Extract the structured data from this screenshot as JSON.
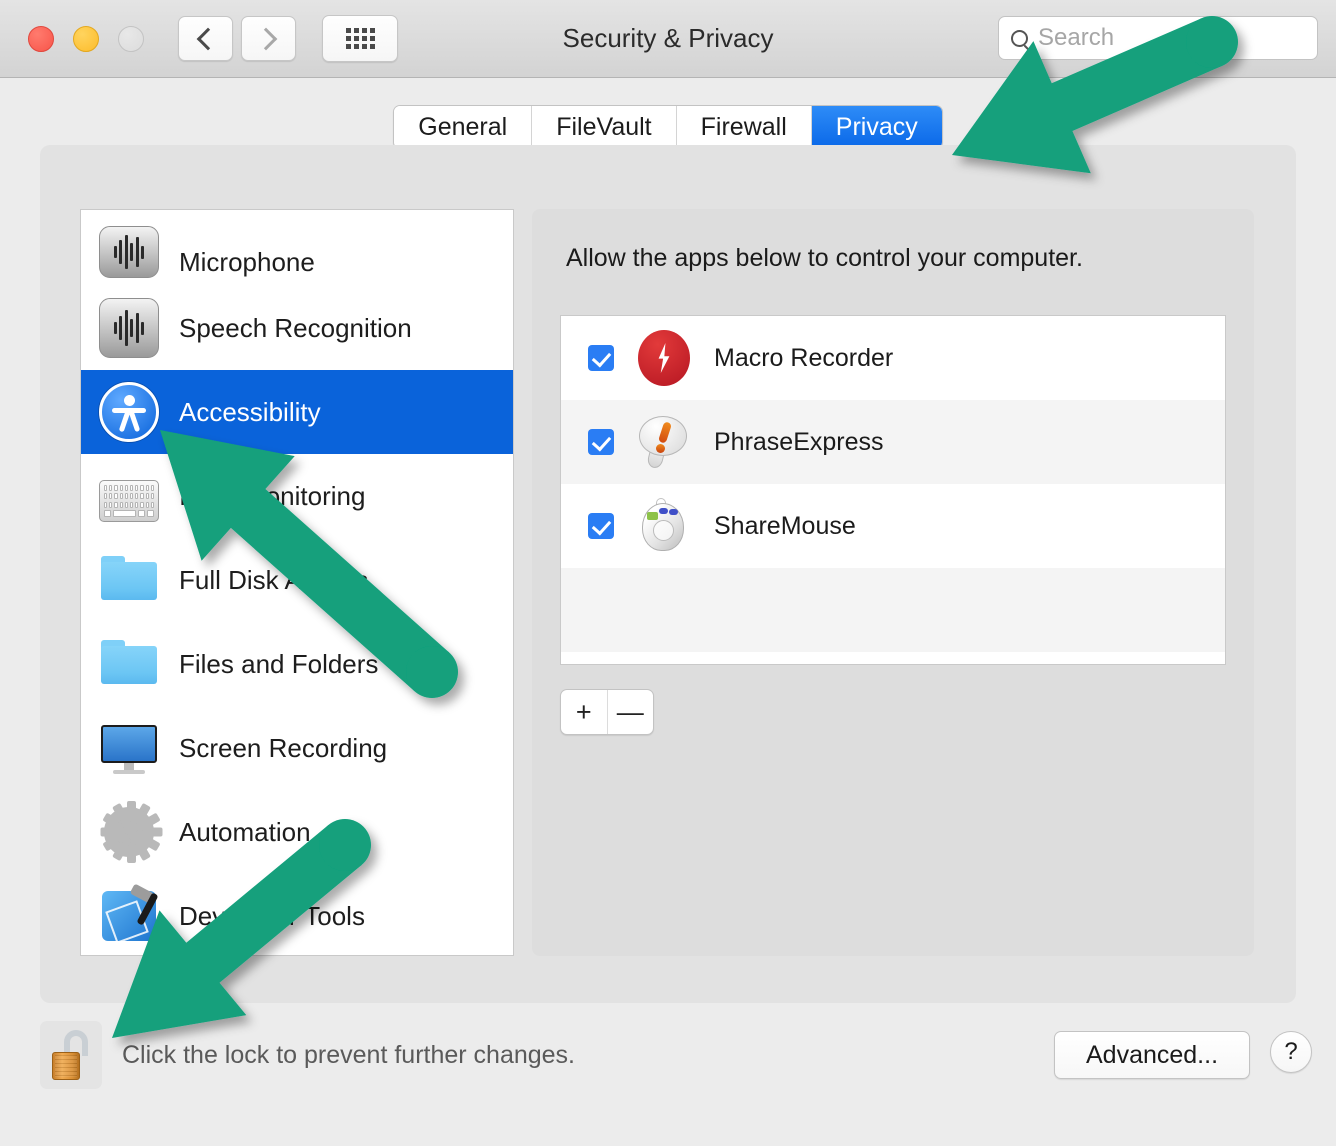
{
  "window": {
    "title": "Security & Privacy",
    "traffic_lights": [
      "close",
      "minimize",
      "zoom"
    ],
    "nav": {
      "back": "back-chevron",
      "forward": "forward-chevron",
      "show_all": "grid-icon"
    },
    "search": {
      "placeholder": "Search",
      "value": "",
      "icon": "search-icon"
    }
  },
  "tabs": [
    {
      "label": "General",
      "active": false
    },
    {
      "label": "FileVault",
      "active": false
    },
    {
      "label": "Firewall",
      "active": false
    },
    {
      "label": "Privacy",
      "active": true
    }
  ],
  "sidebar": {
    "items": [
      {
        "label": "Microphone",
        "icon": "microphone-icon",
        "selected": false
      },
      {
        "label": "Speech Recognition",
        "icon": "microphone-icon",
        "selected": false
      },
      {
        "label": "Accessibility",
        "icon": "accessibility-icon",
        "selected": true
      },
      {
        "label": "Input Monitoring",
        "icon": "keyboard-icon",
        "selected": false
      },
      {
        "label": "Full Disk Access",
        "icon": "folder-icon",
        "selected": false
      },
      {
        "label": "Files and Folders",
        "icon": "folder-icon",
        "selected": false
      },
      {
        "label": "Screen Recording",
        "icon": "display-icon",
        "selected": false
      },
      {
        "label": "Automation",
        "icon": "gear-icon",
        "selected": false
      },
      {
        "label": "Developer Tools",
        "icon": "developer-tools-icon",
        "selected": false
      }
    ]
  },
  "detail": {
    "description": "Allow the apps below to control your computer.",
    "apps": [
      {
        "name": "Macro Recorder",
        "checked": true,
        "icon": "macro-recorder-icon"
      },
      {
        "name": "PhraseExpress",
        "checked": true,
        "icon": "phraseexpress-icon"
      },
      {
        "name": "ShareMouse",
        "checked": true,
        "icon": "sharemouse-icon"
      }
    ],
    "add_label": "+",
    "remove_label": "—"
  },
  "footer": {
    "lock_icon": "unlocked-padlock-icon",
    "lock_text": "Click the lock to prevent further changes.",
    "advanced_label": "Advanced...",
    "help_label": "?"
  },
  "annotations": {
    "arrow_color": "#12a07c",
    "arrows": [
      {
        "target": "tab-privacy",
        "direction": "down-left"
      },
      {
        "target": "sidebar-item-accessibility",
        "direction": "up-left"
      },
      {
        "target": "lock-button",
        "direction": "down-left"
      }
    ]
  }
}
